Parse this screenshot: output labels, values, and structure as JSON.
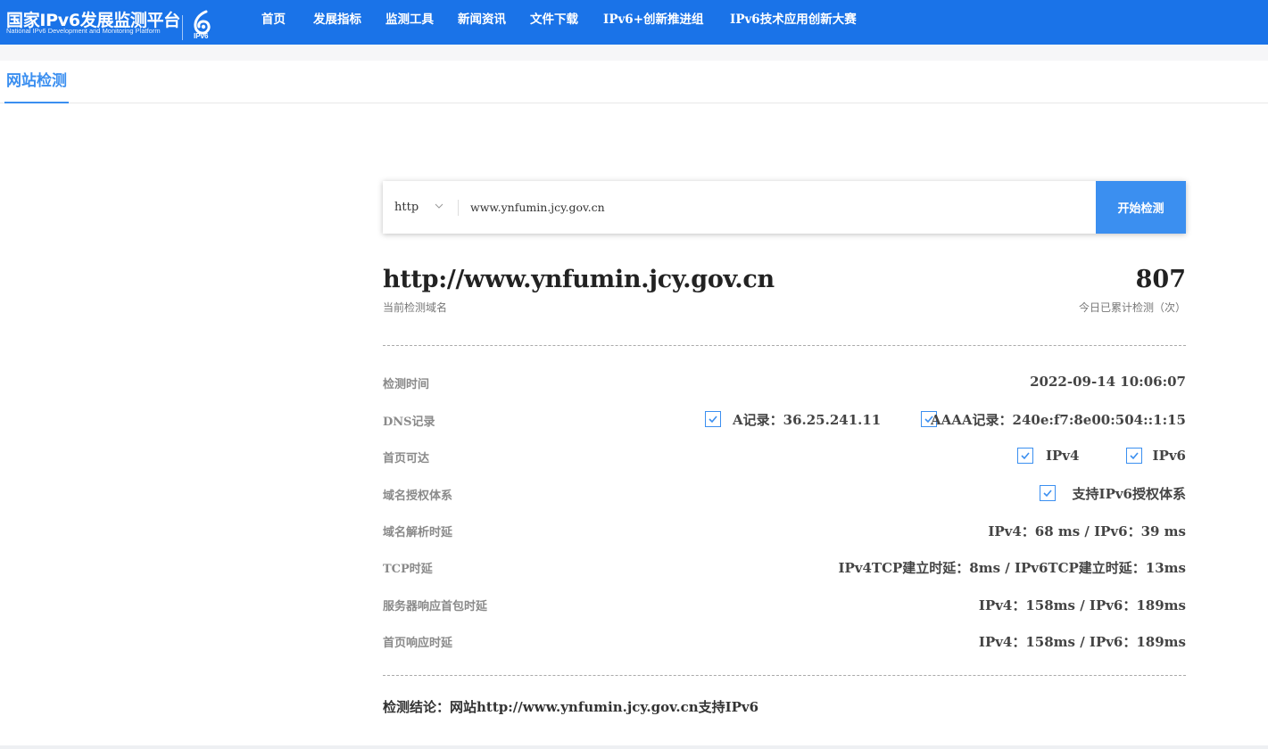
{
  "header": {
    "brand_title": "国家IPv6发展监测平台",
    "brand_subtitle": "National IPv6 Development and Monitoring Platform",
    "logo_text": "IPv6",
    "nav": [
      "首页",
      "发展指标",
      "监测工具",
      "新闻资讯",
      "文件下载",
      "IPv6+创新推进组",
      "IPv6技术应用创新大赛"
    ]
  },
  "tabs": {
    "active": "网站检测"
  },
  "search": {
    "protocol": "http",
    "url_value": "www.ynfumin.jcy.gov.cn",
    "button_label": "开始检测"
  },
  "result": {
    "domain": "http://www.ynfumin.jcy.gov.cn",
    "domain_caption": "当前检测域名",
    "count": "807",
    "count_caption": "今日已累计检测（次）",
    "rows": {
      "time": {
        "label": "检测时间",
        "value": "2022-09-14 10:06:07"
      },
      "dns": {
        "label": "DNS记录",
        "a": "A记录：36.25.241.11",
        "aaaa": "AAAA记录：240e:f7:8e00:504::1:15"
      },
      "reach": {
        "label": "首页可达",
        "ipv4": "IPv4",
        "ipv6": "IPv6"
      },
      "auth": {
        "label": "域名授权体系",
        "value": "支持IPv6授权体系"
      },
      "resolve": {
        "label": "域名解析时延",
        "value": "IPv4：68 ms / IPv6：39 ms"
      },
      "tcp": {
        "label": "TCP时延",
        "value": "IPv4TCP建立时延：8ms / IPv6TCP建立时延：13ms"
      },
      "firstpack": {
        "label": "服务器响应首包时延",
        "value": "IPv4：158ms / IPv6：189ms"
      },
      "homepage": {
        "label": "首页响应时延",
        "value": "IPv4：158ms / IPv6：189ms"
      }
    },
    "conclusion": "检测结论：网站http://www.ynfumin.jcy.gov.cn支持IPv6"
  },
  "colors": {
    "primary": "#1a73e8",
    "accent": "#3b8ff0"
  }
}
